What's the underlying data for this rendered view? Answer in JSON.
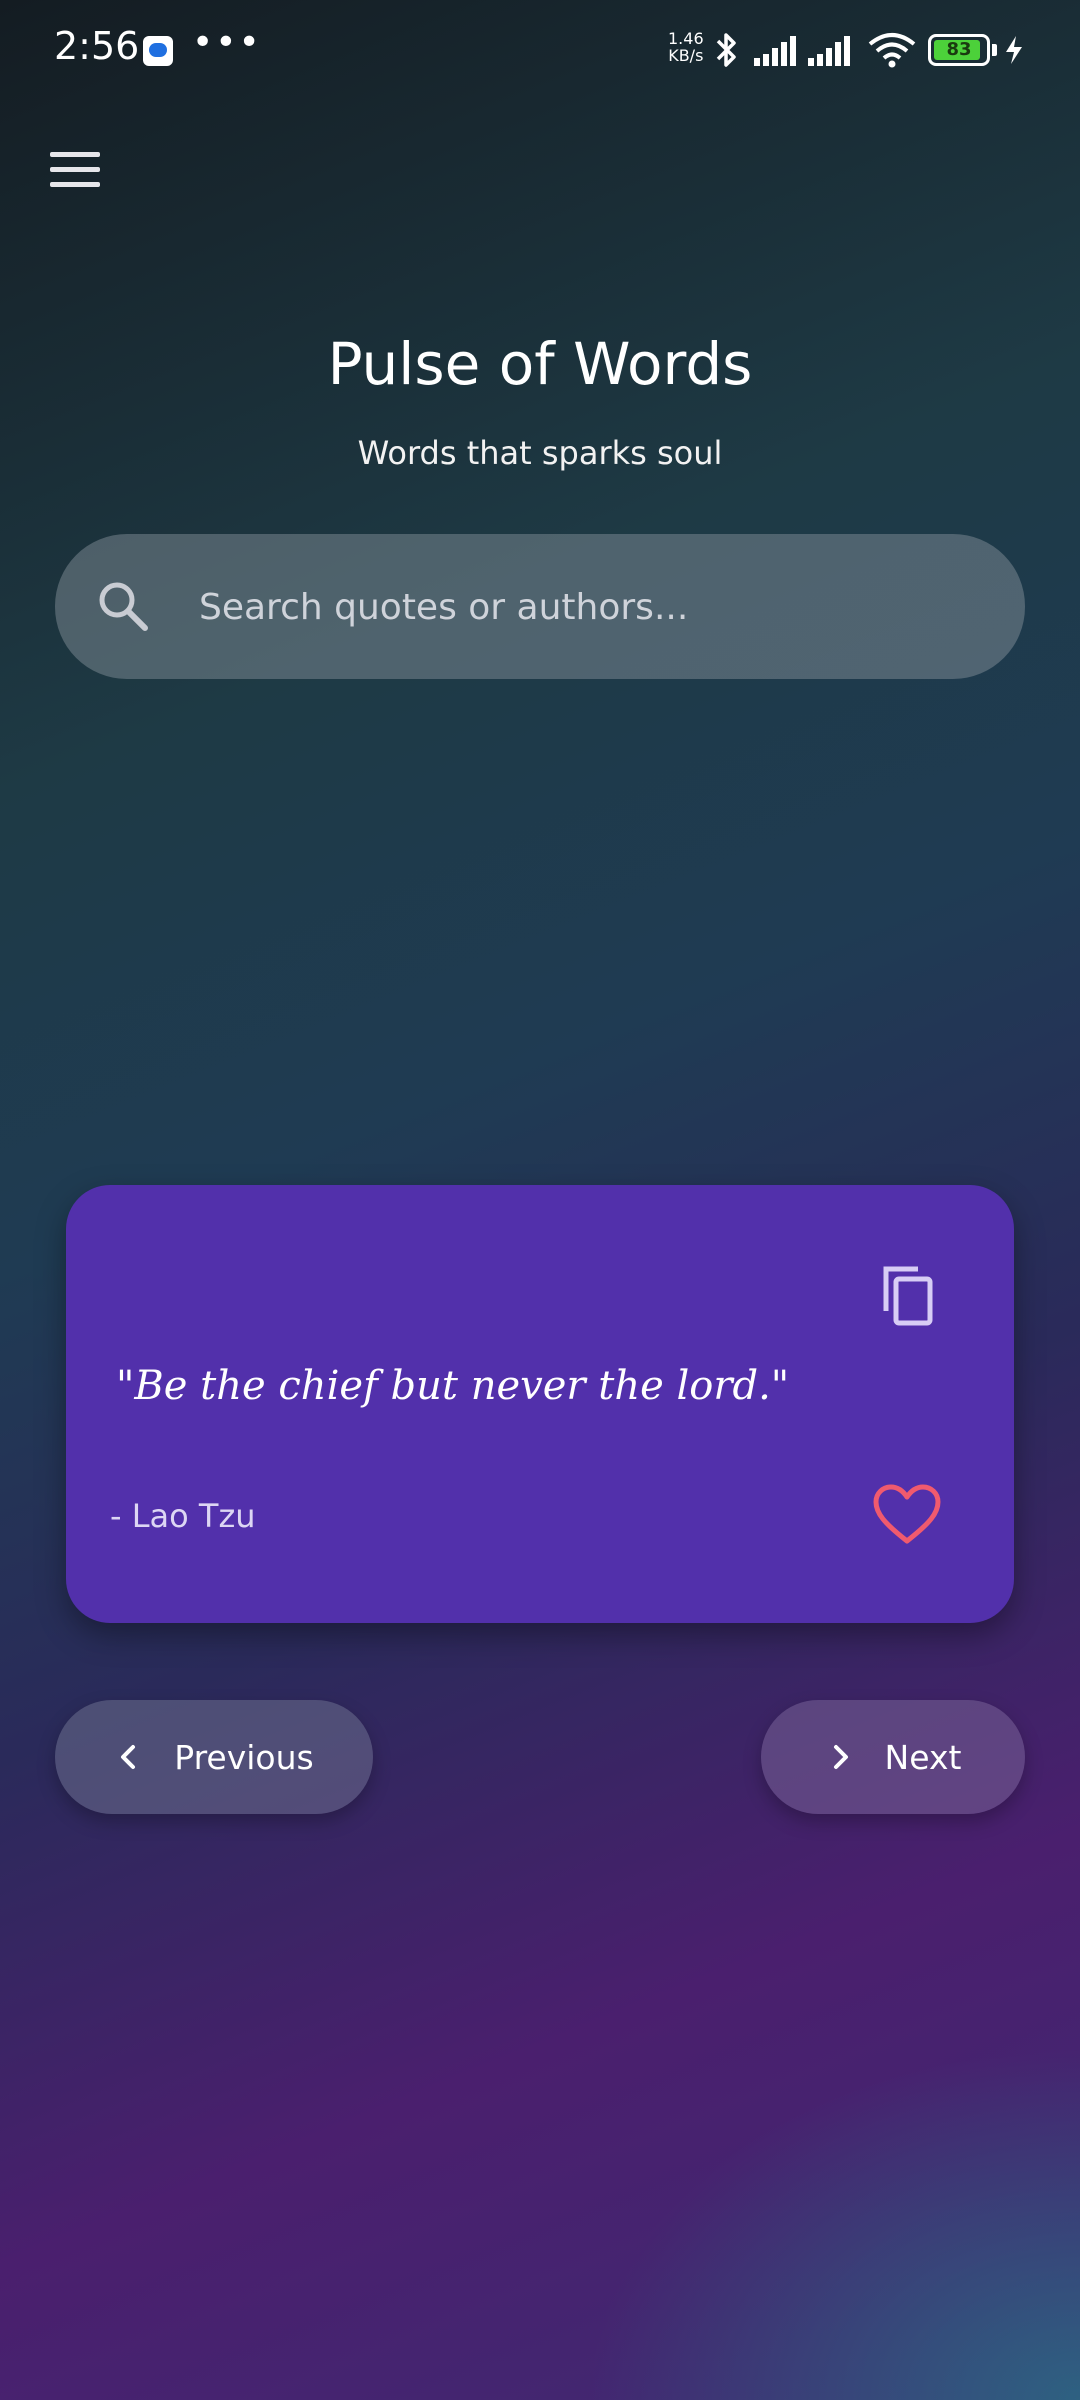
{
  "status_bar": {
    "time": "2:56",
    "more_dots": "•••",
    "network_speed_value": "1.46",
    "network_speed_unit": "KB/s",
    "battery_level": "83",
    "battery_color": "#4cd13a"
  },
  "app": {
    "title": "Pulse of Words",
    "subtitle": "Words that sparks soul"
  },
  "search": {
    "placeholder": "Search quotes or authors..."
  },
  "quote_card": {
    "text": "\"Be the chief but never the lord.\"",
    "author": "- Lao Tzu",
    "card_color": "#5230ab",
    "heart_color": "#f05a6e"
  },
  "navigation": {
    "previous_label": "Previous",
    "next_label": "Next"
  },
  "icons": [
    "menu-icon",
    "search-icon",
    "copy-icon",
    "heart-icon",
    "chevron-left-icon",
    "chevron-right-icon",
    "bluetooth-icon",
    "signal-icon",
    "wifi-icon",
    "battery-icon",
    "charging-icon"
  ]
}
